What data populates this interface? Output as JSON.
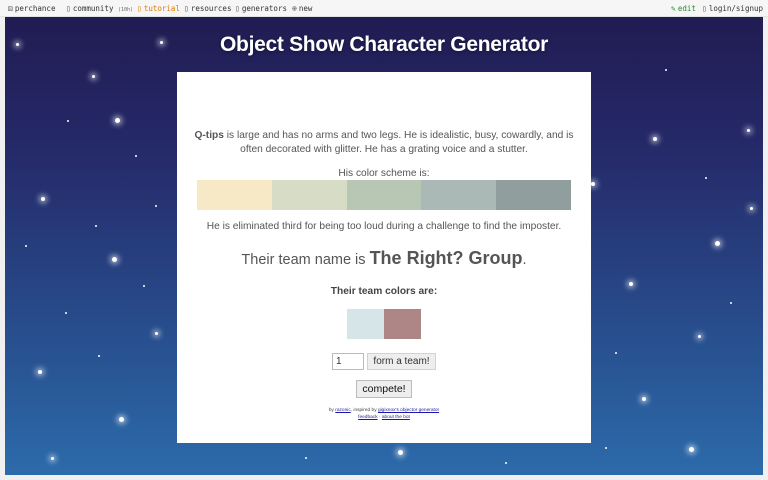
{
  "nav": {
    "brand": "perchance",
    "community": "community",
    "community_count": "(10h)",
    "tutorial": "tutorial",
    "resources": "resources",
    "generators": "generators",
    "new": "new",
    "edit": "edit",
    "login": "login/signup"
  },
  "icons": {
    "brand": "dice-icon",
    "community": "chat-icon",
    "new": "plus-circle-icon",
    "edit": "pencil-icon"
  },
  "main": {
    "title": "Object Show Character Generator",
    "character": {
      "name": "Q-tips",
      "description": "is large and has no arms and two legs. He is idealistic, busy, cowardly, and is often decorated with glitter. He has a grating voice and a stutter."
    },
    "color_scheme_label": "His color scheme is:",
    "color_scheme": [
      "#f7e8c6",
      "#d6dcc5",
      "#b8c6b4",
      "#abb9b6",
      "#919e9e"
    ],
    "elimination": "He is eliminated third for being too loud during a challenge to find the imposter.",
    "team_prefix": "Their team name is ",
    "team_name": "The Right? Group",
    "team_suffix": ".",
    "team_colors_label": "Their team colors are:",
    "team_colors": [
      "#d6e5e7",
      "#ad8685"
    ],
    "team_count_value": "1",
    "form_team_label": "form a team!",
    "compete_label": "compete!",
    "credits": {
      "by": "by ",
      "author": "razonic",
      "inspired": ", inspired by ",
      "inspiration": "gigixnox's objector generator",
      "feedback": "feedback",
      "sep": " · ",
      "about": "about the bot"
    }
  },
  "colors": {
    "accent_tutorial": "#e07b00",
    "accent_edit": "#2a8a2a",
    "background_top": "#211c52",
    "background_bottom": "#2c6bab"
  }
}
